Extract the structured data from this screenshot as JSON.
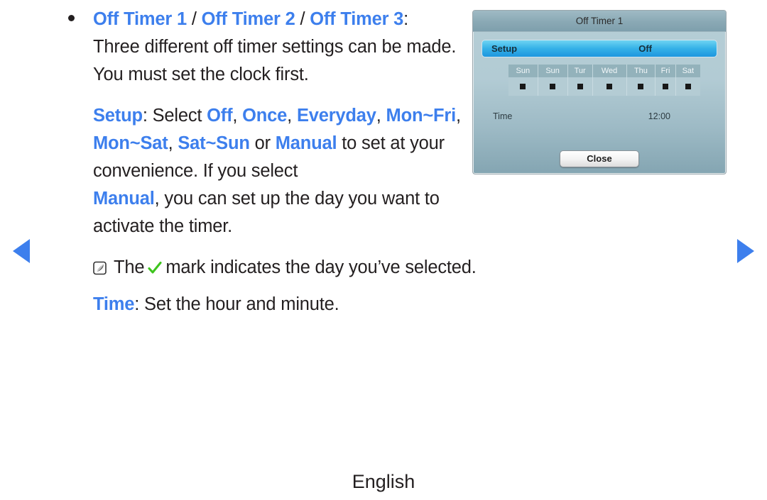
{
  "nav": {
    "prev_label": "previous page",
    "next_label": "next page"
  },
  "content": {
    "heading": {
      "item1": "Off Timer 1",
      "sep1": " / ",
      "item2": "Off Timer 2",
      "sep2": " / ",
      "item3": "Off Timer 3",
      "colon": ":"
    },
    "paragraph1": "Three different off timer settings can be made. You must set the clock first.",
    "setup_line": {
      "label": "Setup",
      "select_text": ": Select ",
      "options": [
        "Off",
        "Once",
        "Everyday",
        "Mon~Fri",
        "Mon~Sat",
        "Sat~Sun"
      ],
      "or_text": " or ",
      "manual": "Manual",
      "tail": "to set at your convenience. If you select"
    },
    "manual_sentence": {
      "keyword": "Manual",
      "rest": ", you can set up the day you want to activate the timer."
    },
    "note": {
      "icon": "note-icon",
      "before_check": "The",
      "check_icon": "green-check-icon",
      "after_check": "mark indicates the day you’ve selected."
    },
    "time_line": {
      "label": "Time",
      "rest": ": Set the hour and minute."
    }
  },
  "osd": {
    "title": "Off Timer 1",
    "setup": {
      "label": "Setup",
      "value": "Off"
    },
    "days": {
      "headers": [
        "Sun",
        "Sun",
        "Tur",
        "Wed",
        "Thu",
        "Fri",
        "Sat"
      ],
      "marks": [
        "■",
        "■",
        "■",
        "■",
        "■",
        "■",
        "■"
      ]
    },
    "time": {
      "label": "Time",
      "value": "12:00"
    },
    "close_label": "Close"
  },
  "footer": {
    "language": "English"
  },
  "colors": {
    "accent_blue": "#3d7fed",
    "text_black": "#231f20",
    "panel_top": "#b6ced6",
    "panel_bottom": "#84a5b2",
    "titlebar": "#8aa9b5",
    "setup_bar_top": "#6fd3f2",
    "setup_bar_bottom": "#1e96de",
    "check_green": "#3ec41e"
  }
}
